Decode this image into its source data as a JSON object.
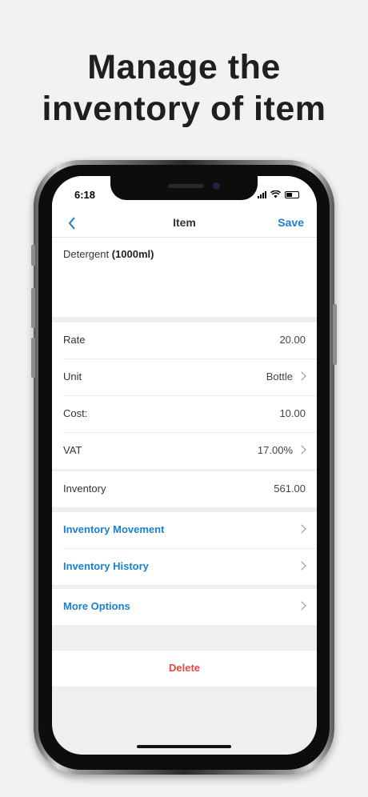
{
  "headline": {
    "line1": "Manage the",
    "line2": "inventory of item"
  },
  "status_bar": {
    "time": "6:18"
  },
  "navbar": {
    "back_icon": "chevron-left-icon",
    "title": "Item",
    "save_label": "Save"
  },
  "item": {
    "name": "Detergent",
    "size": "(1000ml)"
  },
  "details": [
    {
      "label": "Rate",
      "value": "20.00",
      "chevron": false
    },
    {
      "label": "Unit",
      "value": "Bottle",
      "chevron": true
    },
    {
      "label": "Cost:",
      "value": "10.00",
      "chevron": false
    },
    {
      "label": "VAT",
      "value": "17.00%",
      "chevron": true
    }
  ],
  "inventory": {
    "label": "Inventory",
    "value": "561.00"
  },
  "links": {
    "movement": "Inventory Movement",
    "history": "Inventory History",
    "more": "More Options"
  },
  "delete_label": "Delete",
  "colors": {
    "accent": "#1b7fd4",
    "danger": "#e04a3f",
    "background": "#efeff1"
  }
}
